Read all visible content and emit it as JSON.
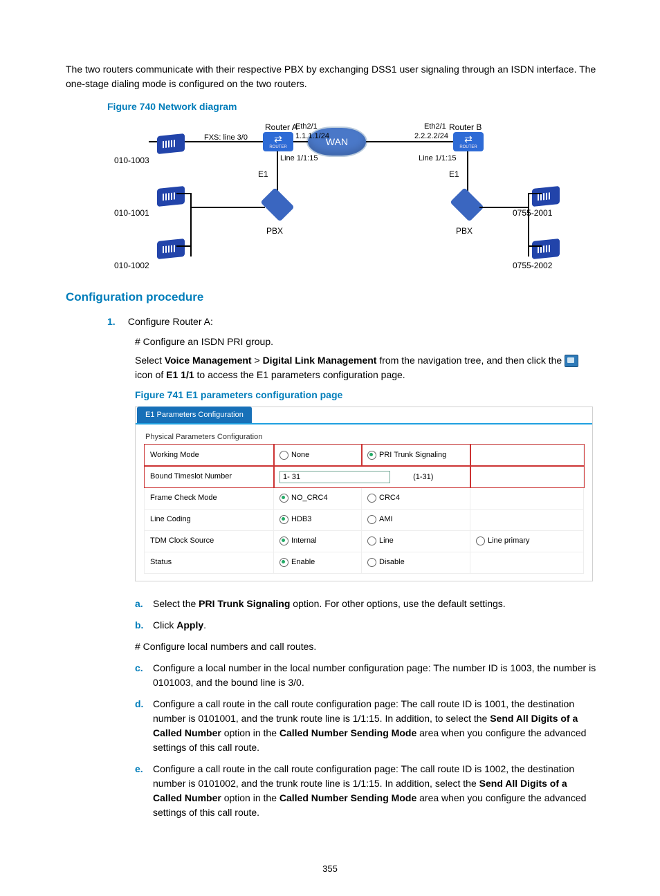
{
  "intro": "The two routers communicate with their respective PBX by exchanging DSS1 user signaling through an ISDN interface. The one-stage dialing mode is configured on the two routers.",
  "fig740_caption": "Figure 740 Network diagram",
  "diagram": {
    "routerA": "Router A",
    "routerB": "Router B",
    "eth21_a": "Eth2/1",
    "eth21_b": "Eth2/1",
    "ip_a": "1.1.1.1/24",
    "ip_b": "2.2.2.2/24",
    "fxs": "FXS: line 3/0",
    "line_a": "Line 1/1:15",
    "line_b": "Line 1/1:15",
    "e1_a": "E1",
    "e1_b": "E1",
    "pbx_a": "PBX",
    "pbx_b": "PBX",
    "wan": "WAN",
    "ph_010_1003": "010-1003",
    "ph_010_1001": "010-1001",
    "ph_010_1002": "010-1002",
    "ph_0755_2001": "0755-2001",
    "ph_0755_2002": "0755-2002"
  },
  "section_config": "Configuration procedure",
  "step1_num": "1.",
  "step1_text": "Configure Router A:",
  "hash_isdn": "# Configure an ISDN PRI group.",
  "select_prefix": "Select ",
  "voice_mgmt": "Voice Management",
  "gt": " > ",
  "dlm": "Digital Link Management",
  "select_suffix": " from the navigation tree, and then click the ",
  "icon_suffix1": " icon of ",
  "e1_11": "E1 1/1",
  "icon_suffix2": " to access the E1 parameters configuration page.",
  "fig741_caption": "Figure 741 E1 parameters configuration page",
  "e1panel": {
    "tab": "E1 Parameters Configuration",
    "legend": "Physical Parameters Configuration",
    "rows": {
      "working_mode": {
        "label": "Working Mode",
        "opt_none": "None",
        "opt_pri": "PRI Trunk Signaling"
      },
      "bound": {
        "label": "Bound Timeslot Number",
        "value": "1- 31",
        "range": "(1-31)"
      },
      "frame": {
        "label": "Frame Check Mode",
        "opt1": "NO_CRC4",
        "opt2": "CRC4"
      },
      "linecoding": {
        "label": "Line Coding",
        "opt1": "HDB3",
        "opt2": "AMI"
      },
      "tdm": {
        "label": "TDM Clock Source",
        "opt1": "Internal",
        "opt2": "Line",
        "opt3": "Line primary"
      },
      "status": {
        "label": "Status",
        "opt1": "Enable",
        "opt2": "Disable"
      }
    }
  },
  "hash_local": "# Configure local numbers and call routes.",
  "letters": {
    "a": {
      "l": "a.",
      "t1": "Select the ",
      "b1": "PRI Trunk Signaling",
      "t2": " option. For other options, use the default settings."
    },
    "b": {
      "l": "b.",
      "t1": "Click ",
      "b1": "Apply",
      "t2": "."
    },
    "c": {
      "l": "c.",
      "t": "Configure a local number in the local number configuration page: The number ID is 1003, the number is 0101003, and the bound line is 3/0."
    },
    "d": {
      "l": "d.",
      "t1": "Configure a call route in the call route configuration page: The call route ID is 1001, the destination number is 0101001, and the trunk route line is 1/1:15. In addition, to select the ",
      "b1": "Send All Digits of a Called Number",
      "t2": " option in the ",
      "b2": "Called Number Sending Mode",
      "t3": " area when you configure the advanced settings of this call route."
    },
    "e": {
      "l": "e.",
      "t1": "Configure a call route in the call route configuration page: The call route ID is 1002, the destination number is 0101002, and the trunk route line is 1/1:15. In addition, select the ",
      "b1": "Send All Digits of a Called Number",
      "t2": " option in the ",
      "b2": "Called Number Sending Mode",
      "t3": " area when you configure the advanced settings of this call route."
    }
  },
  "pagenum": "355"
}
